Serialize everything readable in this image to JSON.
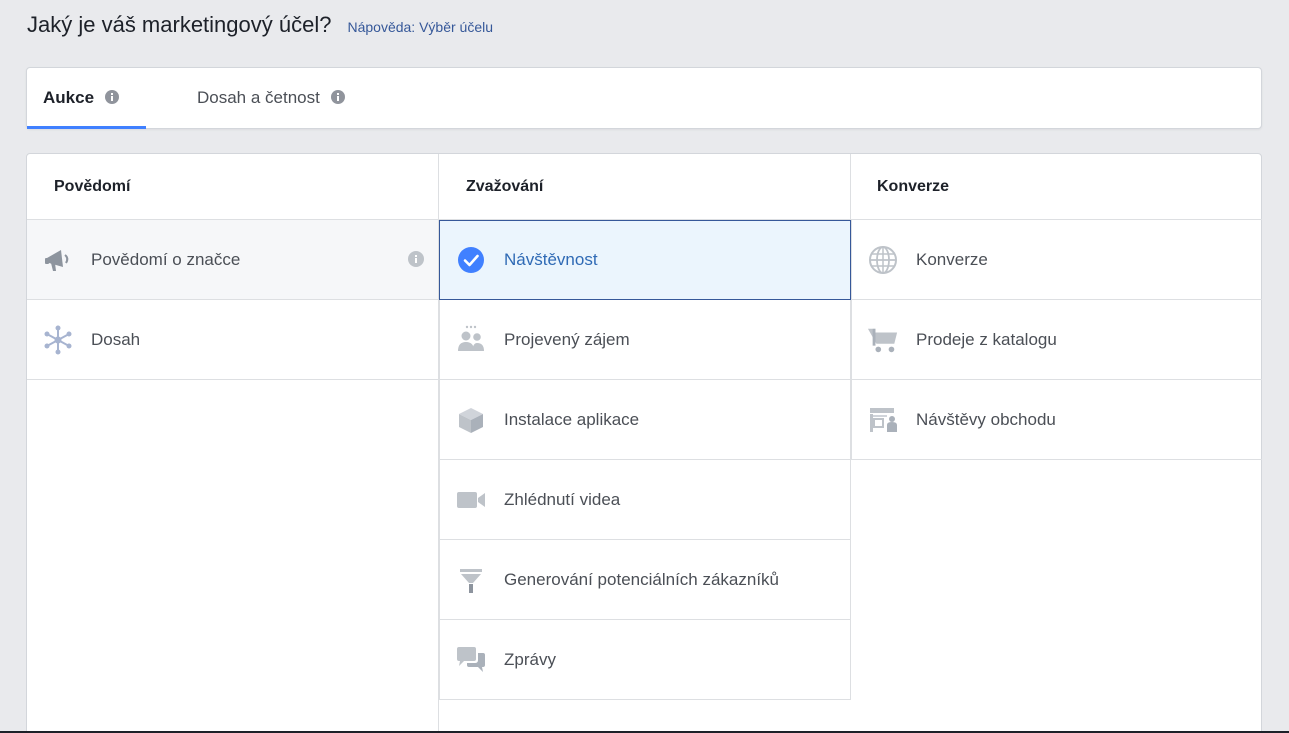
{
  "header": {
    "title": "Jaký je váš marketingový účel?",
    "help_link": "Nápověda: Výběr účelu"
  },
  "tabs": [
    {
      "label": "Aukce",
      "active": true
    },
    {
      "label": "Dosah a četnost",
      "active": false
    }
  ],
  "columns": [
    {
      "heading": "Povědomí",
      "items": [
        {
          "label": "Povědomí o značce",
          "icon": "megaphone-icon",
          "has_info": true
        },
        {
          "label": "Dosah",
          "icon": "reach-icon"
        }
      ]
    },
    {
      "heading": "Zvažování",
      "items": [
        {
          "label": "Návštěvnost",
          "icon": "check-circle-icon",
          "selected": true
        },
        {
          "label": "Projevený zájem",
          "icon": "people-icon"
        },
        {
          "label": "Instalace aplikace",
          "icon": "box-icon"
        },
        {
          "label": "Zhlédnutí videa",
          "icon": "video-camera-icon"
        },
        {
          "label": "Generování potenciálních zákazníků",
          "icon": "funnel-icon"
        },
        {
          "label": "Zprávy",
          "icon": "chat-bubbles-icon"
        }
      ]
    },
    {
      "heading": "Konverze",
      "items": [
        {
          "label": "Konverze",
          "icon": "globe-icon"
        },
        {
          "label": "Prodeje z katalogu",
          "icon": "cart-icon"
        },
        {
          "label": "Návštěvy obchodu",
          "icon": "store-icon"
        }
      ]
    }
  ],
  "colors": {
    "accent": "#4080ff",
    "link": "#365899",
    "selected_bg": "#ebf5fd",
    "icon_gray": "#bec3c9",
    "icon_dark": "#8d949e"
  }
}
